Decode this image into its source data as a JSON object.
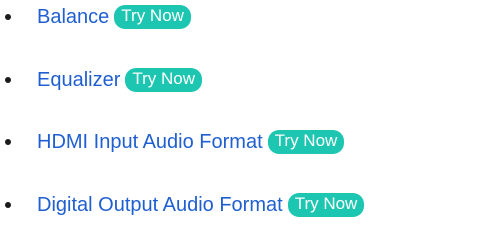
{
  "items": [
    {
      "label": "Balance",
      "action_label": "Try Now"
    },
    {
      "label": "Equalizer",
      "action_label": "Try Now"
    },
    {
      "label": "HDMI Input Audio Format",
      "action_label": "Try Now"
    },
    {
      "label": "Digital Output Audio Format",
      "action_label": "Try Now"
    }
  ],
  "colors": {
    "link": "#1f5fd1",
    "try_now_bg": "#1cc6b1",
    "try_now_text": "#ffffff",
    "bullet": "#1a1a1a"
  }
}
